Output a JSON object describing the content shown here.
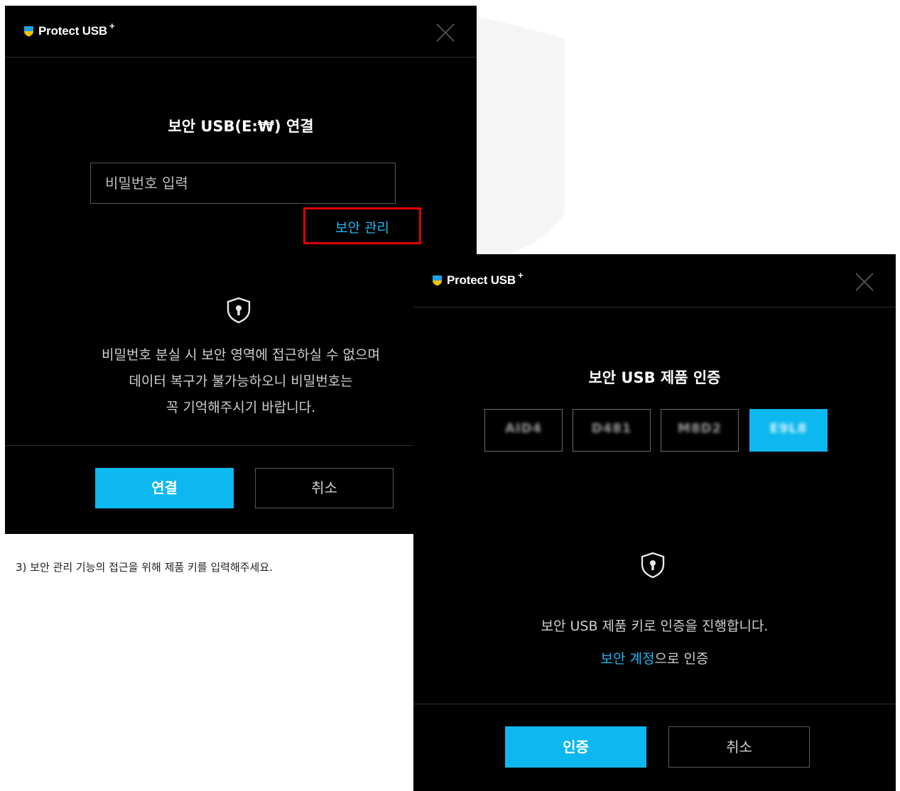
{
  "login_dialog": {
    "app_title": "Protect USB",
    "app_title_superscript": "+",
    "heading": "보안 USB(E:₩) 연결",
    "password_placeholder": "비밀번호 입력",
    "security_link": "보안 관리",
    "notice_lines": [
      "비밀번호 분실 시 보안 영역에 접근하실 수 없으며",
      "데이터 복구가 불가능하오니 비밀번호는",
      "꼭 기억해주시기 바랍니다."
    ],
    "connect_button": "연결",
    "cancel_button": "취소"
  },
  "auth_dialog": {
    "app_title": "Protect USB",
    "app_title_superscript": "+",
    "heading": "보안 USB 제품 인증",
    "product_key_fields": [
      "AID4",
      "D481",
      "M8D2",
      "E9L8"
    ],
    "active_key_index": 3,
    "notice": "보안 USB 제품 키로 인증을 진행합니다.",
    "account_link": "보안 계정",
    "account_suffix": "으로 인증",
    "auth_button": "인증",
    "cancel_button": "취소"
  },
  "caption": "3) 보안 관리 기능의 접근을 위해 제품 키를 입력해주세요.",
  "colors": {
    "accent": "#0cb8ef",
    "link": "#1fb6ef",
    "highlight_box": "#e00000",
    "dialog_bg": "#000000"
  },
  "icons": [
    "shield-logo-icon",
    "close-icon",
    "shield-keyhole-icon"
  ]
}
